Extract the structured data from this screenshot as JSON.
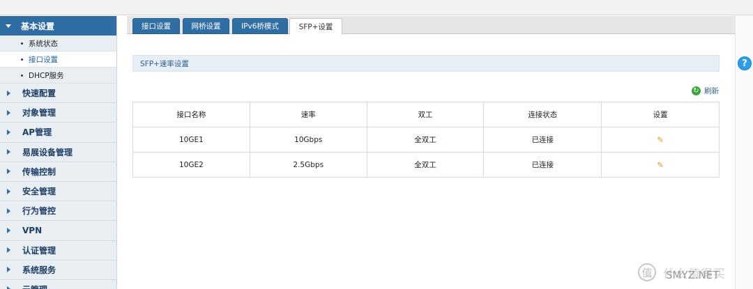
{
  "sidebar": {
    "header": "基本设置",
    "subitems": [
      {
        "label": "系统状态",
        "active": false
      },
      {
        "label": "接口设置",
        "active": true
      },
      {
        "label": "DHCP服务",
        "active": false
      }
    ],
    "items": [
      "快速配置",
      "对象管理",
      "AP管理",
      "易展设备管理",
      "传输控制",
      "安全管理",
      "行为管控",
      "VPN",
      "认证管理",
      "系统服务",
      "云管理"
    ]
  },
  "tabs": [
    {
      "label": "接口设置",
      "active": false
    },
    {
      "label": "网桥设置",
      "active": false
    },
    {
      "label": "IPv6桥模式",
      "active": false
    },
    {
      "label": "SFP+设置",
      "active": true
    }
  ],
  "section": {
    "title": "SFP+速率设置"
  },
  "refresh": {
    "label": "刷新"
  },
  "table": {
    "columns": [
      "接口名称",
      "速率",
      "双工",
      "连接状态",
      "设置"
    ],
    "rows": [
      {
        "name": "10GE1",
        "rate": "10Gbps",
        "duplex": "全双工",
        "status": "已连接"
      },
      {
        "name": "10GE2",
        "rate": "2.5Gbps",
        "duplex": "全双工",
        "status": "已连接"
      }
    ]
  },
  "help": {
    "glyph": "?"
  },
  "watermark": {
    "text": "什么值得买",
    "text2": "SMYZ.NET"
  },
  "colors": {
    "accent": "#2f6ea5",
    "section_bg": "#e6eef6",
    "help": "#2a9ee8",
    "refresh": "#3aa33a"
  }
}
